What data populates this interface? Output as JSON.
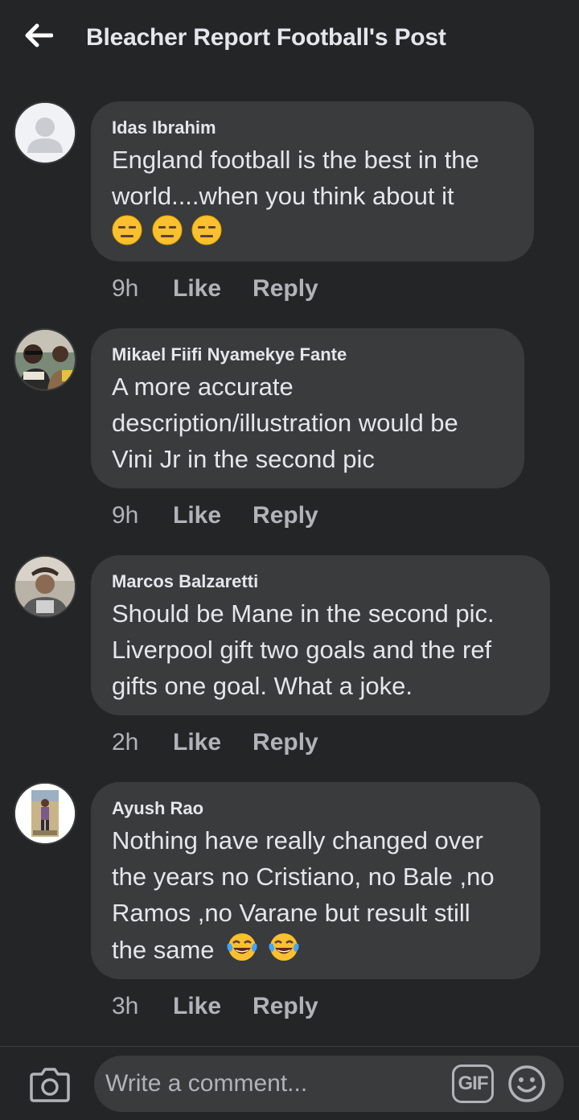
{
  "header": {
    "title": "Bleacher Report Football's Post",
    "back_icon": "arrow-left-icon"
  },
  "comments": [
    {
      "author": "Idas Ibrahim",
      "lines": [
        "England football is the best in the",
        "world....when you think about it"
      ],
      "emoji": [
        "expressionless-face",
        "expressionless-face",
        "expressionless-face"
      ],
      "time": "9h",
      "like": "Like",
      "reply": "Reply"
    },
    {
      "author": "Mikael Fiifi Nyamekye Fante",
      "lines": [
        "A more accurate",
        "description/illustration would be",
        "Vini Jr in the second pic"
      ],
      "time": "9h",
      "like": "Like",
      "reply": "Reply"
    },
    {
      "author": "Marcos Balzaretti",
      "lines": [
        "Should be Mane in the second pic.",
        "Liverpool gift two goals and the ref",
        "gifts one goal. What a joke."
      ],
      "time": "2h",
      "like": "Like",
      "reply": "Reply"
    },
    {
      "author": "Ayush Rao",
      "lines": [
        "Nothing have really changed over",
        "the years no Cristiano, no Bale ,no",
        "Ramos ,no Varane but result still",
        "the same"
      ],
      "emoji": [
        "tears-of-joy",
        "tears-of-joy"
      ],
      "time": "3h",
      "like": "Like",
      "reply": "Reply"
    }
  ],
  "composer": {
    "placeholder": "Write a comment...",
    "gif_label": "GIF",
    "camera_icon": "camera-icon",
    "emoji_icon": "smiley-icon"
  },
  "colors": {
    "background": "#242526",
    "bubble": "#3a3b3c",
    "primary_text": "#e4e6eb",
    "secondary_text": "#b0b3b8"
  }
}
